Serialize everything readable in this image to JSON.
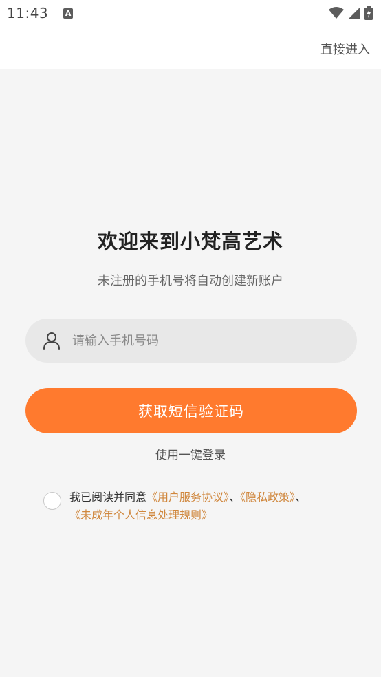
{
  "status_bar": {
    "time": "11:43",
    "notification_icon": "a-icon",
    "right_icons": [
      "wifi-icon",
      "signal-icon",
      "battery-charging-icon"
    ]
  },
  "header": {
    "enter_label": "直接进入"
  },
  "main": {
    "title": "欢迎来到小梵高艺术",
    "subtitle": "未注册的手机号将自动创建新账户",
    "phone_placeholder": "请输入手机号码",
    "phone_value": "",
    "user_icon": "user-icon",
    "sms_button_label": "获取短信验证码",
    "oneclick_label": "使用一键登录"
  },
  "agreement": {
    "checked": false,
    "prefix": "我已阅读并同意",
    "user_agreement": "《用户服务协议》",
    "separator1": "、",
    "privacy_policy": "《隐私政策》",
    "separator2": "、",
    "minor_rules": "《未成年个人信息处理规则》"
  },
  "colors": {
    "accent": "#ff7a2e",
    "link": "#d0873d",
    "background": "#f5f5f5",
    "input_bg": "#e8e8e8"
  }
}
